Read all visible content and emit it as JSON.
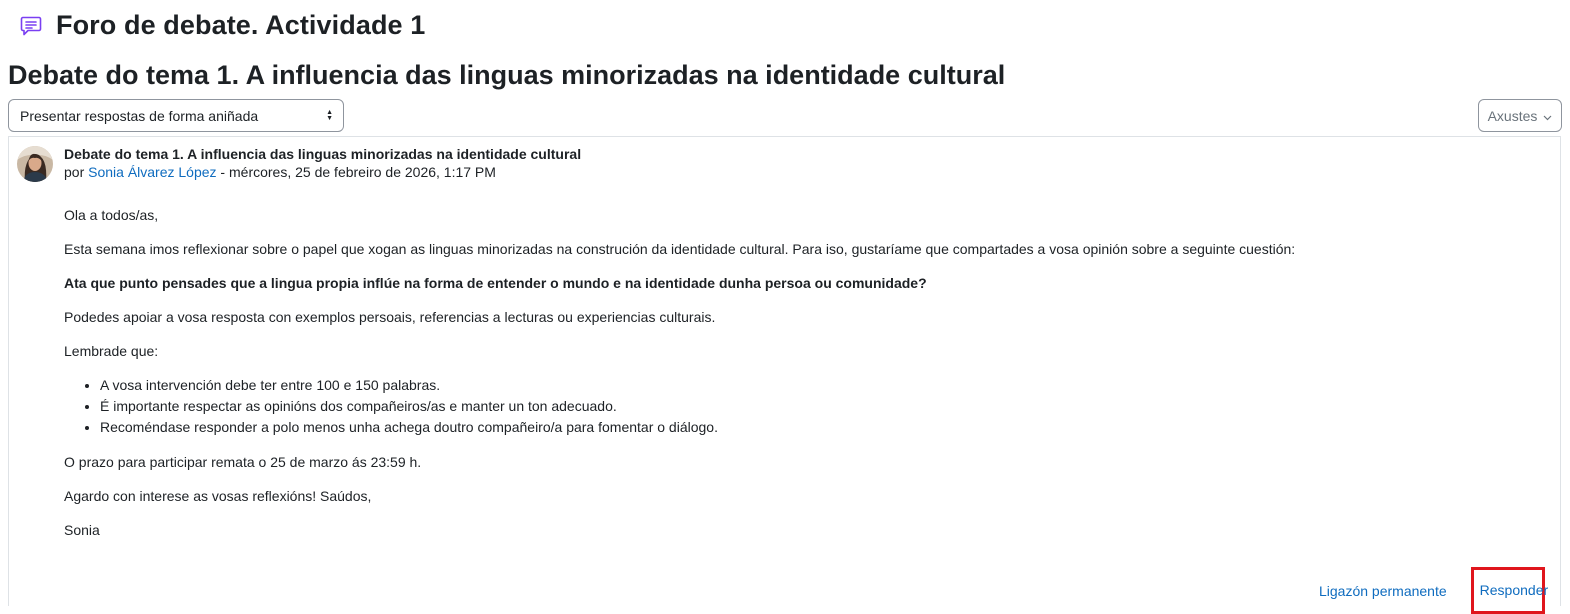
{
  "forum": {
    "icon": "forum-discussion-icon",
    "icon_color": "#7a3ff2",
    "title": "Foro de debate. Actividade 1"
  },
  "discussion": {
    "title": "Debate do tema 1. A influencia das linguas minorizadas na identidade cultural"
  },
  "controls": {
    "display_mode": "Presentar respostas de forma aniñada",
    "settings_label": "Axustes"
  },
  "post": {
    "subject": "Debate do tema 1. A influencia das linguas minorizadas na identidade cultural",
    "by_prefix": "por",
    "author": "Sonia Álvarez López",
    "date_separator": " - ",
    "date": "mércores, 25 de febreiro de 2026, 1:17 PM",
    "body": {
      "greeting": "Ola a todos/as,",
      "intro": "Esta semana imos reflexionar sobre o papel que xogan as linguas minorizadas na construción da identidade cultural. Para iso, gustaríame que compartades a vosa opinión sobre a seguinte cuestión:",
      "question": "Ata que punto pensades que a lingua propia inflúe na forma de entender o mundo e na identidade dunha persoa ou comunidade?",
      "support": "Podedes apoiar a vosa resposta con exemplos persoais, referencias a lecturas ou experiencias culturais.",
      "reminder_heading": "Lembrade que:",
      "reminders": [
        "A vosa intervención debe ter entre 100 e 150 palabras.",
        "É importante respectar as opinións dos compañeiros/as e manter un ton adecuado.",
        "Recoméndase responder a polo menos unha achega doutro compañeiro/a para fomentar o diálogo."
      ],
      "deadline": "O prazo para participar remata o 25 de marzo ás 23:59 h.",
      "closing": "Agardo con interese as vosas reflexións! Saúdos,",
      "signature": "Sonia"
    },
    "actions": {
      "permalink": "Ligazón permanente",
      "reply": "Responder"
    }
  },
  "colors": {
    "link": "#0f6cbf",
    "highlight_border": "#e0161d",
    "border": "#dee2e6"
  }
}
